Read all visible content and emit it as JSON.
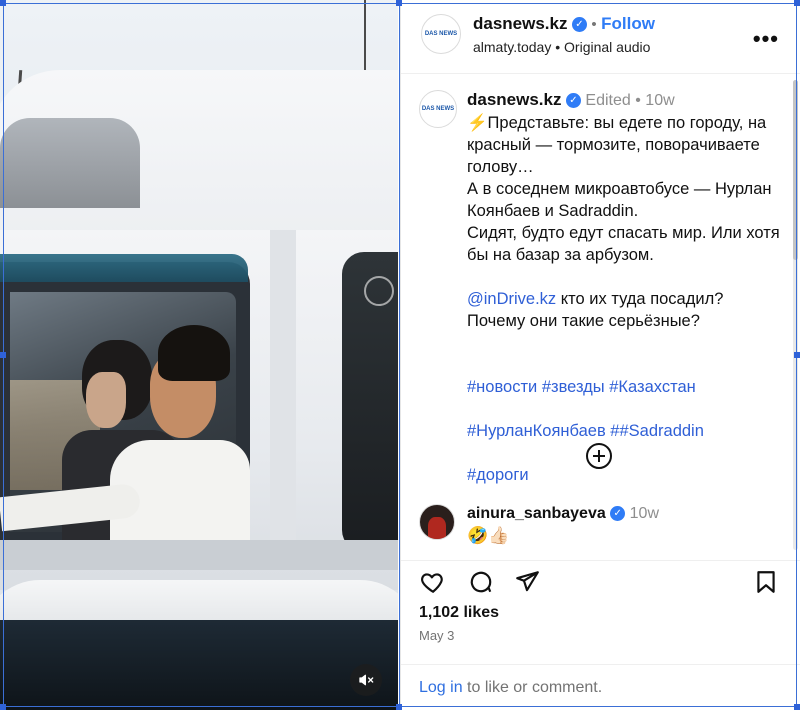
{
  "header": {
    "username": "dasnews.kz",
    "separator": "•",
    "follow_label": "Follow",
    "location": "almaty.today",
    "audio_separator": "•",
    "audio": "Original audio",
    "avatar_logo_text": "DAS NEWS",
    "more_icon": "more-horizontal-icon"
  },
  "caption": {
    "username": "dasnews.kz",
    "edited": "Edited",
    "separator": "•",
    "time": "10w",
    "emoji": "⚡",
    "paragraph1": "Представьте: вы едете по городу, на красный — тормозите, поворачиваете голову…\nА в соседнем микроавтобусе — Нурлан Коянбаев и Sadraddin.\nСидят, будто едут спасать мир. Или хотя бы на базар за арбузом.",
    "mention": "@inDrive.kz",
    "paragraph2": " кто их туда посадил? Почему они такие серьёзные?",
    "hashtags_line1": "#новости #звезды #Казахстан",
    "hashtags_line2_a": "#НурланКоянбаев #",
    "hashtags_line2_b": "#Sadraddin",
    "hashtags_line3": "#дороги",
    "load_more_icon": "plus-circle-icon"
  },
  "comment": {
    "username": "ainura_sanbayeva",
    "time": "10w",
    "text": "🤣👍🏻"
  },
  "actions": {
    "like_icon": "heart-icon",
    "comment_icon": "comment-icon",
    "share_icon": "paper-plane-icon",
    "save_icon": "bookmark-icon"
  },
  "likes": "1,102 likes",
  "date": "May 3",
  "login": {
    "link_label": "Log in",
    "rest": " to like or comment."
  },
  "media": {
    "mute_icon": "speaker-muted-icon",
    "car_logo_text": "JD"
  },
  "colors": {
    "accent_blue": "#2f7cf6",
    "link_blue": "#2f5fd6",
    "muted_gray": "#737373",
    "selection_border": "#3b6fd6"
  }
}
